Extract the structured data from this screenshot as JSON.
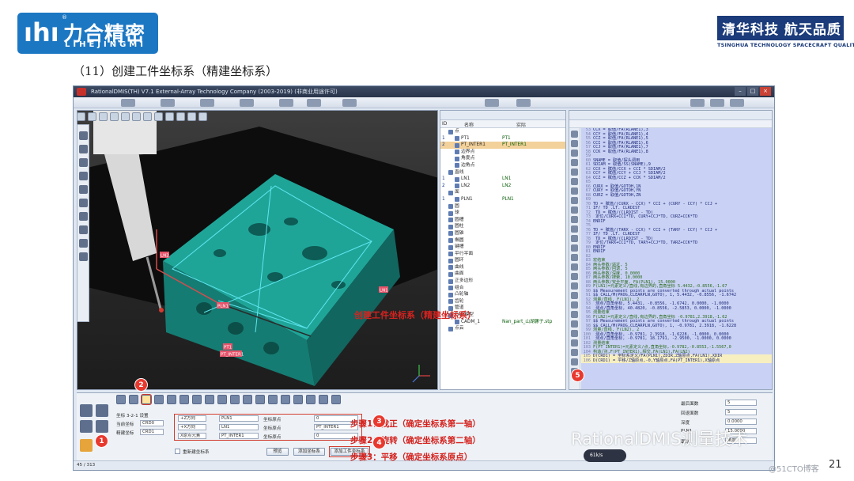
{
  "header": {
    "logo_left_cn": "力合精密",
    "logo_left_en": "LIHEJINGMI",
    "logo_left_mark": "ıhı",
    "logo_right_cn": "清华科技 航天品质",
    "logo_right_en": "TSINGHUA TECHNOLOGY SPACECRAFT QUALITY",
    "slide_title": "（11）创建工件坐标系（精建坐标系）"
  },
  "app": {
    "title": "RationalDMIS(TH) V7.1    External-Array Technology Company (2003-2019) (非商业用途许可)",
    "tree": {
      "col_id": "ID",
      "col_name": "名称",
      "col_actual": "实际",
      "rows": [
        {
          "id": "",
          "name": "点",
          "actual": "",
          "depth": 1
        },
        {
          "id": "1",
          "name": "PT1",
          "actual": "PT1",
          "depth": 2
        },
        {
          "id": "2",
          "name": "PT_INTER1",
          "actual": "PT_INTER1",
          "depth": 2,
          "selected": true
        },
        {
          "id": "",
          "name": "边界点",
          "actual": "",
          "depth": 2
        },
        {
          "id": "",
          "name": "角度点",
          "actual": "",
          "depth": 2
        },
        {
          "id": "",
          "name": "边角点",
          "actual": "",
          "depth": 2
        },
        {
          "id": "",
          "name": "直线",
          "actual": "",
          "depth": 1
        },
        {
          "id": "1",
          "name": "LN1",
          "actual": "LN1",
          "depth": 2
        },
        {
          "id": "2",
          "name": "LN2",
          "actual": "LN2",
          "depth": 2
        },
        {
          "id": "",
          "name": "面",
          "actual": "",
          "depth": 1
        },
        {
          "id": "1",
          "name": "PLN1",
          "actual": "PLN1",
          "depth": 2
        },
        {
          "id": "",
          "name": "圆",
          "actual": "",
          "depth": 1
        },
        {
          "id": "",
          "name": "球",
          "actual": "",
          "depth": 1
        },
        {
          "id": "",
          "name": "圆槽",
          "actual": "",
          "depth": 1
        },
        {
          "id": "",
          "name": "圆柱",
          "actual": "",
          "depth": 1
        },
        {
          "id": "",
          "name": "圆锥",
          "actual": "",
          "depth": 1
        },
        {
          "id": "",
          "name": "椭圆",
          "actual": "",
          "depth": 1
        },
        {
          "id": "",
          "name": "键槽",
          "actual": "",
          "depth": 1
        },
        {
          "id": "",
          "name": "平行平面",
          "actual": "",
          "depth": 1
        },
        {
          "id": "",
          "name": "圆环",
          "actual": "",
          "depth": 1
        },
        {
          "id": "",
          "name": "曲线",
          "actual": "",
          "depth": 1
        },
        {
          "id": "",
          "name": "曲面",
          "actual": "",
          "depth": 1
        },
        {
          "id": "",
          "name": "正多边形",
          "actual": "",
          "depth": 1
        },
        {
          "id": "",
          "name": "组合",
          "actual": "",
          "depth": 1
        },
        {
          "id": "",
          "name": "凸轮轴",
          "actual": "",
          "depth": 1
        },
        {
          "id": "",
          "name": "齿轮",
          "actual": "",
          "depth": 1
        },
        {
          "id": "",
          "name": "管道",
          "actual": "",
          "depth": 1
        },
        {
          "id": "",
          "name": "CAD模型",
          "actual": "",
          "depth": 1
        },
        {
          "id": "",
          "name": "CADM_1",
          "actual": "Nan_part_山湖骡子.stp",
          "depth": 2
        },
        {
          "id": "",
          "name": "点云",
          "actual": "",
          "depth": 1
        }
      ]
    },
    "code_lines": [
      {
        "n": "53",
        "t": "CCX = 取值/FA(RLANE1),3",
        "g": false
      },
      {
        "n": "54",
        "t": "CCY = 取值/FA(RLANE1),4",
        "g": false
      },
      {
        "n": "55",
        "t": "CCZ = 取值/FA(RLANE1),5",
        "g": false
      },
      {
        "n": "56",
        "t": "CCI = 取值/FA(RLANE1),6",
        "g": false
      },
      {
        "n": "57",
        "t": "CCJ = 取值/FA(RLANE1),7",
        "g": false
      },
      {
        "n": "58",
        "t": "CCK = 取值/FA(RLANE1),8",
        "g": false
      },
      {
        "n": "59",
        "t": "",
        "g": false
      },
      {
        "n": "60",
        "t": "SNAME = 取值/探头调用",
        "g": false
      },
      {
        "n": "61",
        "t": "SDIAM = 取值/SS(SNAME),9",
        "g": false
      },
      {
        "n": "62",
        "t": "CCX = 赋值/CCX + CCI * SDIAM/2",
        "g": false
      },
      {
        "n": "63",
        "t": "CCY = 赋值/CCY + CCJ * SDIAM/2",
        "g": false
      },
      {
        "n": "64",
        "t": "CCZ = 赋值/CCZ + CCK * SDIAM/2",
        "g": false
      },
      {
        "n": "65",
        "t": "",
        "g": false
      },
      {
        "n": "66",
        "t": "CURX = 取值/GOTOH,1N",
        "g": false
      },
      {
        "n": "67",
        "t": "CURY = 取值/GOTOH,YN",
        "g": false
      },
      {
        "n": "68",
        "t": "CURZ = 取值/GOTOH,ZN",
        "g": false
      },
      {
        "n": "69",
        "t": "",
        "g": false
      },
      {
        "n": "70",
        "t": "TD = 赋值/(CURX - CCX) * CCI + (CURY - CCY) * CCJ +",
        "g": false
      },
      {
        "n": "71",
        "t": "IF/ TD .LT. CLRDIST",
        "g": false
      },
      {
        "n": "72",
        "t": "  TD = 赋值/(CLRDIST - TD)",
        "g": false
      },
      {
        "n": "73",
        "t": "  定位/CURX+CCI*TD, CURY+CCJ*TD, CURZ+CCK*TD",
        "g": false
      },
      {
        "n": "74",
        "t": "ENDIF",
        "g": false
      },
      {
        "n": "75",
        "t": "",
        "g": false
      },
      {
        "n": "76",
        "t": "TD = 赋值/(TARX - CCX) * CCI + (TARY - CCY) * CCJ +",
        "g": false
      },
      {
        "n": "77",
        "t": "IF/ TD .LT. CLRDIST",
        "g": false
      },
      {
        "n": "78",
        "t": "  TD = 赋值/(CLRDIST - TD)",
        "g": false
      },
      {
        "n": "79",
        "t": "  定位/TARX+CCI*TD, TARY+CCJ*TD, TARZ+CCK*TD",
        "g": false
      },
      {
        "n": "80",
        "t": "ENDIF",
        "g": false
      },
      {
        "n": "81",
        "t": "ENDIF",
        "g": false
      },
      {
        "n": "82",
        "t": "",
        "g": false
      },
      {
        "n": "83",
        "t": "宏结束",
        "g": true
      },
      {
        "n": "84",
        "t": "两头参数/逼近, 5",
        "g": true
      },
      {
        "n": "85",
        "t": "两头参数/回退, 5",
        "g": true
      },
      {
        "n": "86",
        "t": "两头参数/深度, 0.0000",
        "g": true
      },
      {
        "n": "87",
        "t": "两头参数/搜索, 10.0000",
        "g": true
      },
      {
        "n": "88",
        "t": "两头参数/安全平面, FA(PLN1), 15.0000",
        "g": true
      },
      {
        "n": "89",
        "t": "F(LN1)=元素定义/直线,有边界的,直角坐标 5.4432,-0.8556,-1.67",
        "g": true
      },
      {
        "n": "90",
        "t": "$$ Measurement points are converted through actual points",
        "g": false
      },
      {
        "n": "91",
        "t": "$$ CALL/M(PROG,CLEARPLN,GOTO), 1, 5.4432, -0.8556, -1.6742",
        "g": false
      },
      {
        "n": "92",
        "t": "测量/直线, F(LN1), 2",
        "g": true
      },
      {
        "n": "93",
        "t": "  测点/直角坐标, 5.4431, -0.8556, -1.6742, 0.0000, -1.0000",
        "g": false
      },
      {
        "n": "94",
        "t": "  测点/直角坐标, 40.4820, -0.8556, -2.5853, 0.0000, -1.0000",
        "g": false
      },
      {
        "n": "95",
        "t": "测量结束",
        "g": true
      },
      {
        "n": "96",
        "t": "F(LN2)=元素定义/直线,有边界的,直角坐标 -0.9781,2.3918,-1.62",
        "g": true
      },
      {
        "n": "97",
        "t": "$$ Measurement points are converted through actual points",
        "g": false
      },
      {
        "n": "98",
        "t": "$$ CALL/M(PROG,CLEARPLN,GOTO), 1, -0.9781, 2.3918, -1.6228",
        "g": false
      },
      {
        "n": "99",
        "t": "测量/直线, F(LN2), 2",
        "g": true
      },
      {
        "n": "100",
        "t": "  测点/直角坐标, -0.9781, 2.3918, -1.6228, -1.0000, 0.0000",
        "g": false
      },
      {
        "n": "101",
        "t": "  测点/直角坐标, -0.9781, 18.1791, -2.9500, -1.0000, 0.0000",
        "g": false
      },
      {
        "n": "102",
        "t": "测量结束",
        "g": true
      },
      {
        "n": "103",
        "t": "F(PT_INTER1)=元素定义/点,直角坐标,-0.9782,-0.8553,-1.5567,0",
        "g": true
      },
      {
        "n": "104",
        "t": "构造/点,F(PT_INTER1),相交,FA(LN1),FA(LN2)",
        "g": true
      },
      {
        "n": "105",
        "t": "D(CRD1) = 坐标系定义/FA(PLN1),ZDIR,Z轴原点,FA(LN1),XDIR",
        "g": false,
        "hl": true
      },
      {
        "n": "106",
        "t": "D(CRD1) = 平移/Z轴原点,-0,Y轴原点,FA(PT_INTER1),X轴原点",
        "g": false,
        "hl": true
      }
    ],
    "bottom": {
      "mode_label": "坐标 3-2-1 设置",
      "current_coord_label": "当前坐标",
      "current_coord_value": "CRD0",
      "fine_coord_label": "精建坐标",
      "fine_coord_value": "CRD1",
      "axis_rows": [
        {
          "axis": "+Z方向",
          "feature": "PLN1",
          "elem_label": "坐标原点",
          "value": "0"
        },
        {
          "axis": "+X方向",
          "feature": "LN1",
          "elem_label": "坐标原点",
          "value": "PT_INTER1"
        },
        {
          "axis": "X原点元素",
          "feature": "PT_INTER1",
          "elem_label": "坐标原点",
          "value": "0"
        }
      ],
      "checkbox_label": "重新建坐标系",
      "btn_preview": "预览",
      "btn_add_coord": "添加坐标系",
      "btn_add_workpiece_coord": "添加工件坐标系",
      "status": "45 / 313"
    },
    "props": {
      "rows": [
        {
          "label": "最后面数",
          "value": "5"
        },
        {
          "label": "回退面数",
          "value": "5"
        },
        {
          "label": "深度",
          "value": "0.0000"
        },
        {
          "label": "PLN1",
          "value": "15.0000"
        },
        {
          "label": "毫米",
          "value": "角度"
        }
      ]
    },
    "viewport_labels": [
      {
        "text": "LN2"
      },
      {
        "text": "PLN1"
      },
      {
        "text": "LN1"
      },
      {
        "text": "PT1"
      },
      {
        "text": "PT_INTER1"
      }
    ]
  },
  "steps": {
    "title": "创建工件坐标系（精建坐标系）",
    "step1": "步骤1：找正（确定坐标系第一轴）",
    "step2": "步骤2：旋转（确定坐标系第二轴）",
    "step3": "步骤3：平移（确定坐标系原点）"
  },
  "badges": [
    "1",
    "2",
    "3",
    "4",
    "5"
  ],
  "watermark": "RationalDMIS测量技术",
  "site_mark": "@51CTO博客",
  "page_number": "21",
  "speed_text": "61k/s",
  "colors": {
    "accent_red": "#d4231f",
    "logo_blue": "#1c77c3",
    "part_teal": "#1a9a8f"
  }
}
